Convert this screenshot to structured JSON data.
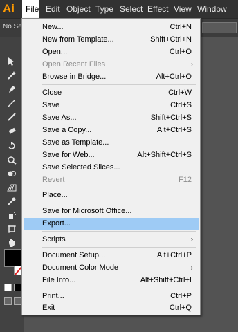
{
  "app": {
    "logo": "Ai"
  },
  "menubar": {
    "items": [
      "File",
      "Edit",
      "Object",
      "Type",
      "Select",
      "Effect",
      "View",
      "Window"
    ]
  },
  "controlbar": {
    "selection_text": "No Se"
  },
  "file_menu": {
    "items": [
      {
        "label": "New...",
        "shortcut": "Ctrl+N"
      },
      {
        "label": "New from Template...",
        "shortcut": "Shift+Ctrl+N"
      },
      {
        "label": "Open...",
        "shortcut": "Ctrl+O"
      },
      {
        "label": "Open Recent Files",
        "shortcut": "",
        "submenu": true,
        "disabled": true
      },
      {
        "label": "Browse in Bridge...",
        "shortcut": "Alt+Ctrl+O"
      },
      {
        "label": "Close",
        "shortcut": "Ctrl+W"
      },
      {
        "label": "Save",
        "shortcut": "Ctrl+S"
      },
      {
        "label": "Save As...",
        "shortcut": "Shift+Ctrl+S"
      },
      {
        "label": "Save a Copy...",
        "shortcut": "Alt+Ctrl+S"
      },
      {
        "label": "Save as Template...",
        "shortcut": ""
      },
      {
        "label": "Save for Web...",
        "shortcut": "Alt+Shift+Ctrl+S"
      },
      {
        "label": "Save Selected Slices...",
        "shortcut": ""
      },
      {
        "label": "Revert",
        "shortcut": "F12",
        "disabled": true
      },
      {
        "label": "Place...",
        "shortcut": ""
      },
      {
        "label": "Save for Microsoft Office...",
        "shortcut": ""
      },
      {
        "label": "Export...",
        "shortcut": "",
        "highlighted": true
      },
      {
        "label": "Scripts",
        "shortcut": "",
        "submenu": true
      },
      {
        "label": "Document Setup...",
        "shortcut": "Alt+Ctrl+P"
      },
      {
        "label": "Document Color Mode",
        "shortcut": "",
        "submenu": true
      },
      {
        "label": "File Info...",
        "shortcut": "Alt+Shift+Ctrl+I"
      },
      {
        "label": "Print...",
        "shortcut": "Ctrl+P"
      },
      {
        "label": "Exit",
        "shortcut": "Ctrl+Q"
      }
    ],
    "submenu_arrow": "›"
  },
  "toolbox": {
    "tools": [
      "selection-tool",
      "direct-selection-tool",
      "magic-wand-tool",
      "lasso-tool",
      "pen-tool",
      "type-tool",
      "line-segment-tool",
      "rectangle-tool",
      "paintbrush-tool",
      "pencil-tool",
      "rotate-tool",
      "scale-tool",
      "warp-tool",
      "free-transform-tool",
      "shape-builder-tool",
      "perspective-grid-tool",
      "mesh-tool",
      "gradient-tool",
      "eyedropper-tool",
      "blend-tool",
      "symbol-sprayer-tool",
      "column-graph-tool",
      "artboard-tool",
      "slice-tool",
      "hand-tool",
      "zoom-tool"
    ]
  },
  "colors": {
    "accent_logo": "#ff9a00",
    "highlight": "#9ecbf5"
  }
}
